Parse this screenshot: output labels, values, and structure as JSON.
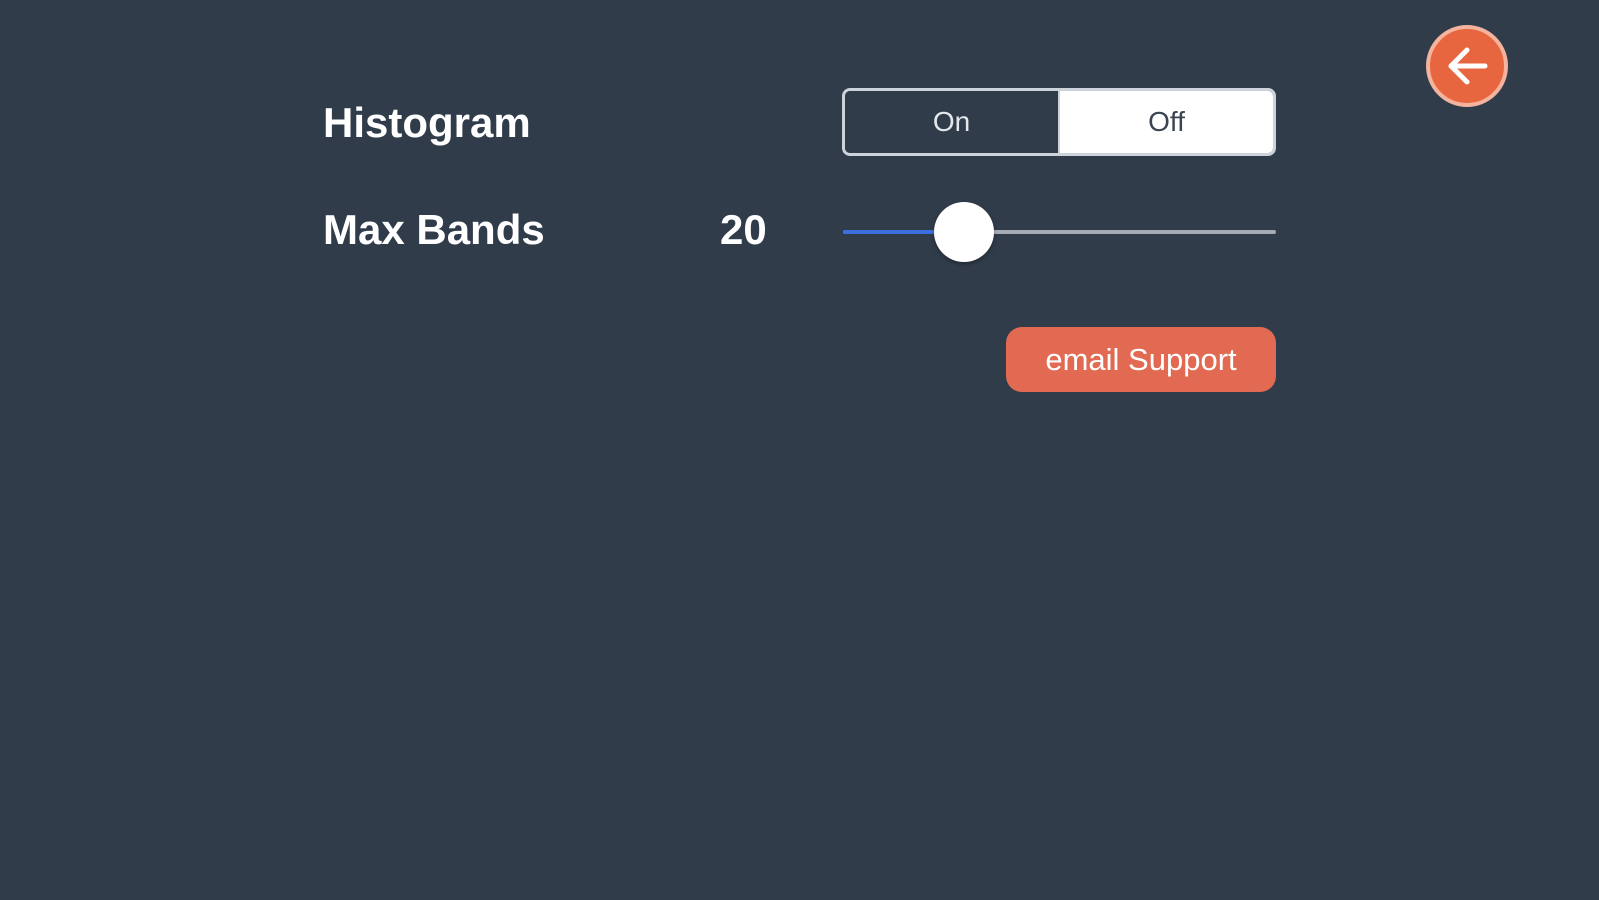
{
  "back_button": {
    "icon": "arrow-left-icon",
    "color": "#e8663f"
  },
  "settings": {
    "histogram": {
      "label": "Histogram",
      "options": [
        "On",
        "Off"
      ],
      "selected": "Off"
    },
    "max_bands": {
      "label": "Max Bands",
      "value": "20",
      "slider_fraction": 0.28
    }
  },
  "support": {
    "email_label": "email Support"
  },
  "colors": {
    "background": "#313c4b",
    "accent": "#e26a52",
    "slider_fill": "#3a6fe0"
  }
}
